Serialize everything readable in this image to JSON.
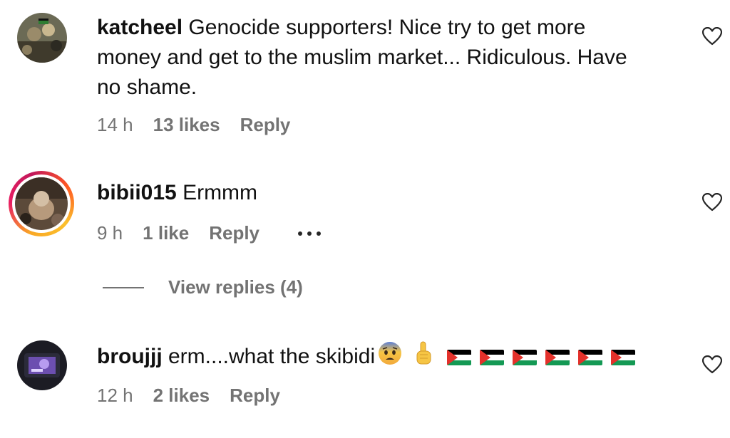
{
  "comments": [
    {
      "username": "katcheel",
      "text": "Genocide supporters! Nice try to get more money and get to the muslim market... Ridiculous. Have no shame.",
      "time": "14 h",
      "likes": "13 likes",
      "reply": "Reply"
    },
    {
      "username": "bibii015",
      "text": "Ermmm",
      "time": "9 h",
      "likes": "1 like",
      "reply": "Reply"
    },
    {
      "username": "broujjj",
      "text": "erm....what the skibidi",
      "time": "12 h",
      "likes": "2 likes",
      "reply": "Reply"
    }
  ],
  "view_replies": "View replies (4)",
  "icons": {
    "like": "heart-outline-icon",
    "more": "more-horizontal-icon",
    "emoji_fear": "fearful-face-emoji",
    "emoji_point": "index-pointing-up-emoji",
    "emoji_flag": "palestine-flag-emoji"
  },
  "flag_count": 6,
  "colors": {
    "text": "#111111",
    "muted": "#737373",
    "story_ring": "#e91e63"
  }
}
